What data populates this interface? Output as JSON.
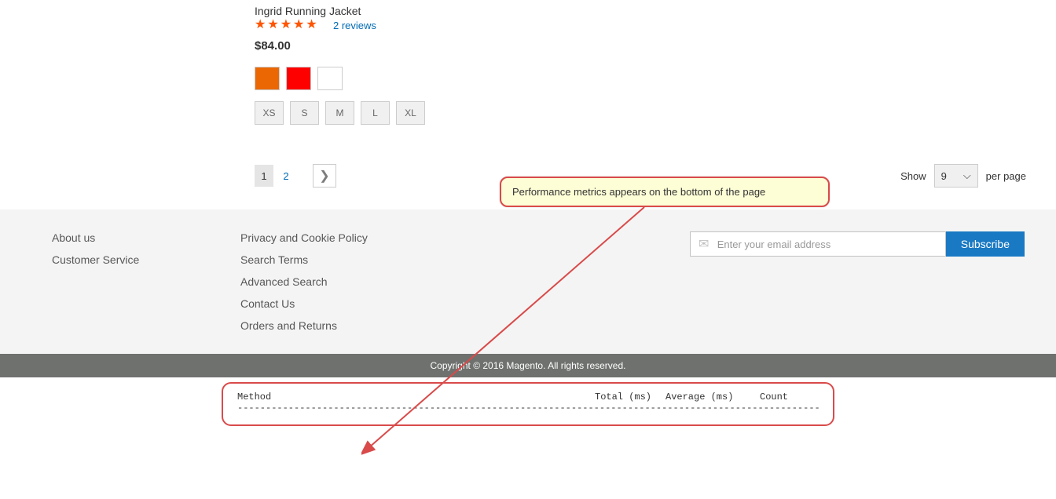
{
  "product": {
    "name": "Ingrid Running Jacket",
    "reviews_text": "2 reviews",
    "rating_percent": 90,
    "price": "$84.00",
    "colors": [
      "orange",
      "red",
      "white"
    ],
    "sizes": [
      "XS",
      "S",
      "M",
      "L",
      "XL"
    ]
  },
  "pagination": {
    "current": "1",
    "next_page": "2",
    "next_icon": "❯"
  },
  "limiter": {
    "label_before": "Show",
    "value": "9",
    "label_after": "per page"
  },
  "footer": {
    "col1": [
      "About us",
      "Customer Service"
    ],
    "col2": [
      "Privacy and Cookie Policy",
      "Search Terms",
      "Advanced Search",
      "Contact Us",
      "Orders and Returns"
    ]
  },
  "newsletter": {
    "placeholder": "Enter your email address",
    "button": "Subscribe"
  },
  "copyright": "Copyright © 2016 Magento. All rights reserved.",
  "metrics": {
    "h1": "Method",
    "h2": "Total (ms)",
    "h3": "Average (ms)",
    "h4": "Count"
  },
  "callout": "Performance metrics appears on the bottom of the page"
}
